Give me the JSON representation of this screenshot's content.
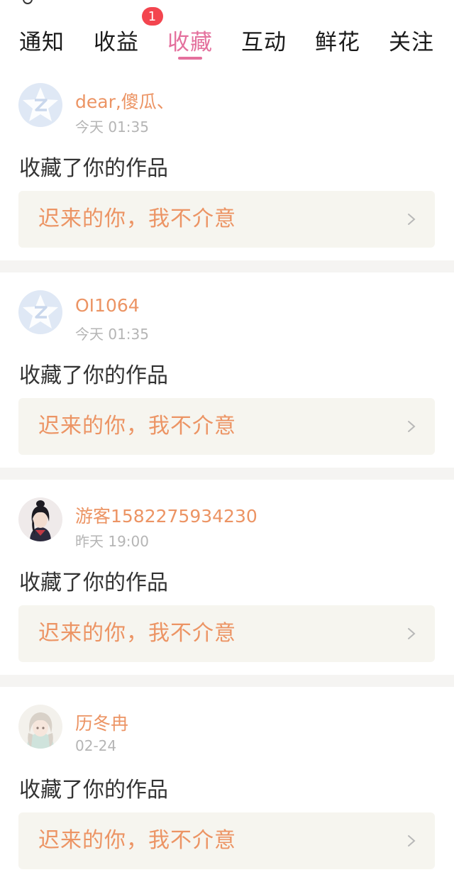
{
  "tabs": [
    {
      "label": "通知"
    },
    {
      "label": "收益",
      "badge": "1"
    },
    {
      "label": "收藏",
      "active": true
    },
    {
      "label": "互动"
    },
    {
      "label": "鲜花"
    },
    {
      "label": "关注"
    }
  ],
  "colors": {
    "accent": "#e4709d",
    "username": "#ec9464",
    "badge": "#f3454f",
    "work_bg": "#f6f5ef"
  },
  "items": [
    {
      "username": "dear,傻瓜、",
      "time": "今天 01:35",
      "action": "收藏了你的作品",
      "work_title": "迟来的你，我不介意",
      "avatar": "default-avatar-icon"
    },
    {
      "username": "OI1064",
      "time": "今天 01:35",
      "action": "收藏了你的作品",
      "work_title": "迟来的你，我不介意",
      "avatar": "default-avatar-icon"
    },
    {
      "username": "游客1582275934230",
      "time": "昨天 19:00",
      "action": "收藏了你的作品",
      "work_title": "迟来的你，我不介意",
      "avatar": "user-photo-avatar"
    },
    {
      "username": "历冬冉",
      "time": "02-24",
      "action": "收藏了你的作品",
      "work_title": "迟来的你，我不介意",
      "avatar": "user-photo-avatar"
    }
  ]
}
